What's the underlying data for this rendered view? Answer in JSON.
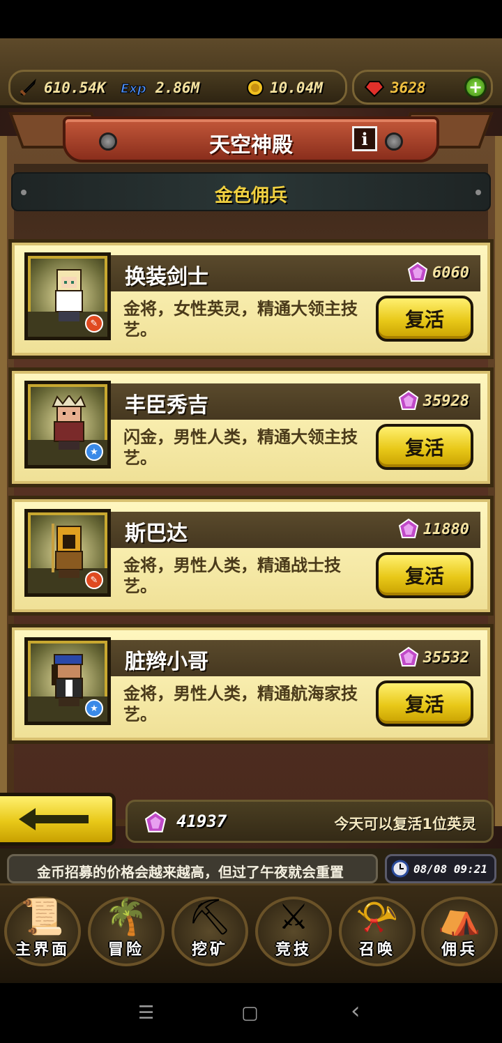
{
  "resources": {
    "attack": "610.54K",
    "exp": "2.86M",
    "gold": "10.04M",
    "rubies": "3628",
    "add_symbol": "+"
  },
  "title": "天空神殿",
  "info_symbol": "i",
  "section_header": "金色佣兵",
  "heroes": [
    {
      "name": "换装剑士",
      "price": "6060",
      "desc": "金将，女性英灵，精通大领主技艺。",
      "button": "复活",
      "badge": "red",
      "colors": {
        "hair": "#f4e6b0",
        "body": "#ffffff"
      }
    },
    {
      "name": "丰臣秀吉",
      "price": "35928",
      "desc": "闪金，男性人类，精通大领主技艺。",
      "button": "复活",
      "badge": "blue",
      "colors": {
        "hair": "#d8d0b0",
        "body": "#7a2a2a"
      }
    },
    {
      "name": "斯巴达",
      "price": "11880",
      "desc": "金将，男性人类，精通战士技艺。",
      "button": "复活",
      "badge": "red",
      "colors": {
        "hair": "#e0a020",
        "body": "#8a5a20"
      }
    },
    {
      "name": "脏辫小哥",
      "price": "35532",
      "desc": "金将，男性人类，精通航海家技艺。",
      "button": "复活",
      "badge": "blue",
      "colors": {
        "hair": "#2a48a8",
        "body": "#2a2a2a"
      }
    }
  ],
  "footer": {
    "gem_count": "41937",
    "note": "今天可以复活1位英灵",
    "ticker": "金币招募的价格会越来越高，但过了午夜就会重置",
    "time": "08/08 09:21"
  },
  "nav": [
    {
      "label": "主界面",
      "icon": "scroll-map-icon",
      "glyph": "📜"
    },
    {
      "label": "冒险",
      "icon": "island-tree-icon",
      "glyph": "🌴"
    },
    {
      "label": "挖矿",
      "icon": "pickaxe-icon",
      "glyph": "⛏"
    },
    {
      "label": "竞技",
      "icon": "crossed-swords-icon",
      "glyph": "⚔"
    },
    {
      "label": "召唤",
      "icon": "summon-scroll-icon",
      "glyph": "📯"
    },
    {
      "label": "佣兵",
      "icon": "tent-icon",
      "glyph": "⛺"
    }
  ],
  "system_nav": {
    "menu": "☰",
    "home": "▢",
    "back": "‹"
  },
  "colors": {
    "gem": "#c040c0",
    "gold_button": "#e8c818",
    "banner": "#b04a30"
  }
}
